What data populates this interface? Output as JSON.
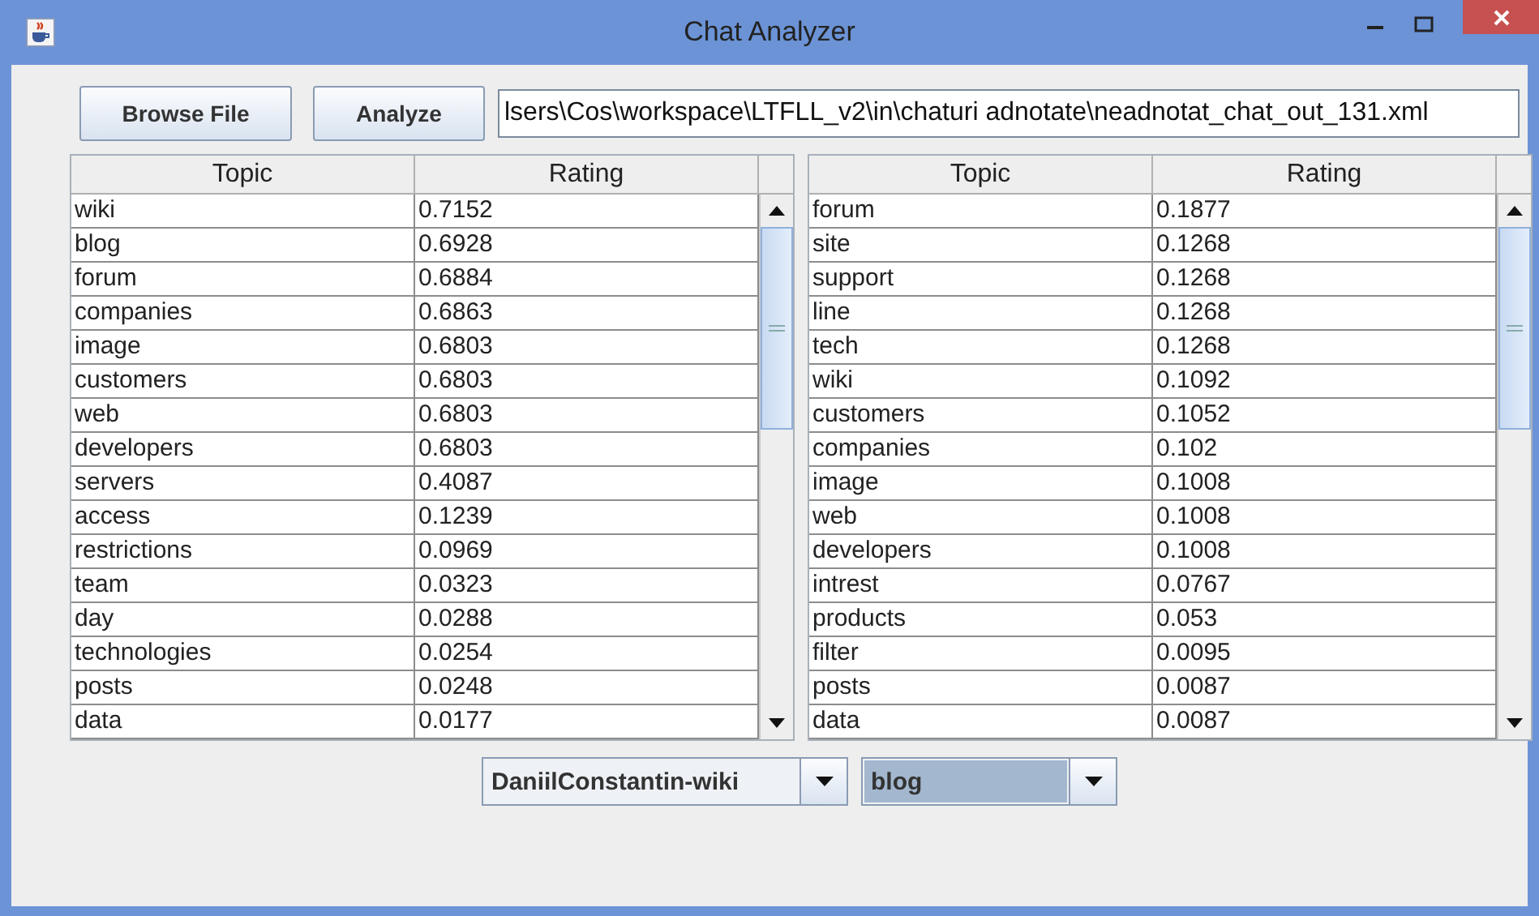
{
  "window": {
    "title": "Chat Analyzer"
  },
  "toolbar": {
    "buttons": [
      "Browse File",
      "Analyze"
    ],
    "path_field": {
      "value": "lsers\\Cos\\workspace\\LTFLL_v2\\in\\chaturi adnotate\\neadnotat_chat_out_131.xml"
    }
  },
  "tables": [
    {
      "columns": [
        "Topic",
        "Rating"
      ],
      "rows": [
        [
          "wiki",
          "0.7152"
        ],
        [
          "blog",
          "0.6928"
        ],
        [
          "forum",
          "0.6884"
        ],
        [
          "companies",
          "0.6863"
        ],
        [
          "image",
          "0.6803"
        ],
        [
          "customers",
          "0.6803"
        ],
        [
          "web",
          "0.6803"
        ],
        [
          "developers",
          "0.6803"
        ],
        [
          "servers",
          "0.4087"
        ],
        [
          "access",
          "0.1239"
        ],
        [
          "restrictions",
          "0.0969"
        ],
        [
          "team",
          "0.0323"
        ],
        [
          "day",
          "0.0288"
        ],
        [
          "technologies",
          "0.0254"
        ],
        [
          "posts",
          "0.0248"
        ],
        [
          "data",
          "0.0177"
        ]
      ]
    },
    {
      "columns": [
        "Topic",
        "Rating"
      ],
      "rows": [
        [
          "forum",
          "0.1877"
        ],
        [
          "site",
          "0.1268"
        ],
        [
          "support",
          "0.1268"
        ],
        [
          "line",
          "0.1268"
        ],
        [
          "tech",
          "0.1268"
        ],
        [
          "wiki",
          "0.1092"
        ],
        [
          "customers",
          "0.1052"
        ],
        [
          "companies",
          "0.102"
        ],
        [
          "image",
          "0.1008"
        ],
        [
          "web",
          "0.1008"
        ],
        [
          "developers",
          "0.1008"
        ],
        [
          "intrest",
          "0.0767"
        ],
        [
          "products",
          "0.053"
        ],
        [
          "filter",
          "0.0095"
        ],
        [
          "posts",
          "0.0087"
        ],
        [
          "data",
          "0.0087"
        ]
      ]
    }
  ],
  "dropdowns": [
    {
      "value": "DaniilConstantin-wiki",
      "focused": false
    },
    {
      "value": "blog",
      "focused": true
    }
  ]
}
